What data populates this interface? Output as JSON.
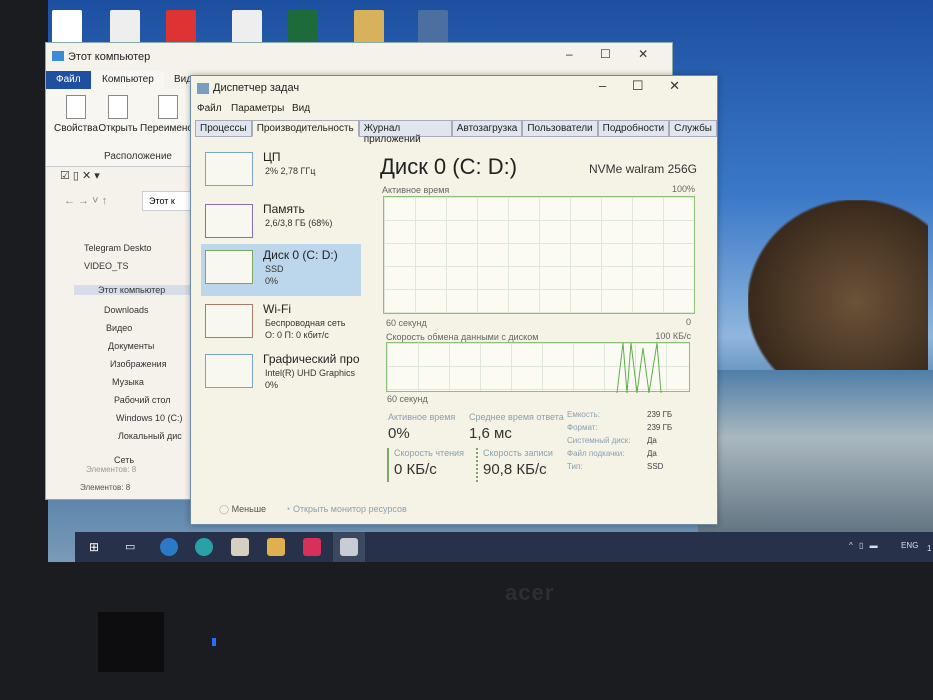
{
  "desktop": {
    "top_icons": [
      "excel-file",
      "blank-file",
      "youtube",
      "document",
      "excel-file",
      "folder",
      "save-file"
    ]
  },
  "explorer": {
    "title": "Этот компьютер",
    "ribbon_tabs": [
      "Файл",
      "Компьютер",
      "Вид"
    ],
    "ribbon_buttons": [
      "Свойства",
      "Открыть",
      "Переименов"
    ],
    "ribbon_group": "Расположение",
    "address": "Этот к",
    "nav_items": [
      "Telegram Deskto",
      "VIDEO_TS",
      "Этот компьютер",
      "Downloads",
      "Видео",
      "Документы",
      "Изображения",
      "Музыка",
      "Рабочий стол",
      "Windows 10 (C:)",
      "Локальный дис",
      "Сеть"
    ],
    "status": "Элементов: 8",
    "status2": "Элементов: 8"
  },
  "taskmgr": {
    "title": "Диспетчер задач",
    "menu": [
      "Файл",
      "Параметры",
      "Вид"
    ],
    "tabs": [
      "Процессы",
      "Производительность",
      "Журнал приложений",
      "Автозагрузка",
      "Пользователи",
      "Подробности",
      "Службы"
    ],
    "sidebar": [
      {
        "name": "ЦП",
        "sub1": "2% 2,78 ГГц",
        "sub2": ""
      },
      {
        "name": "Память",
        "sub1": "2,6/3,8 ГБ (68%)",
        "sub2": ""
      },
      {
        "name": "Диск 0 (C: D:)",
        "sub1": "SSD",
        "sub2": "0%"
      },
      {
        "name": "Wi-Fi",
        "sub1": "Беспроводная сеть",
        "sub2": "О: 0 П: 0 кбит/с"
      },
      {
        "name": "Графический про",
        "sub1": "Intel(R) UHD Graphics",
        "sub2": "0%"
      }
    ],
    "main": {
      "title": "Диск 0 (C: D:)",
      "model": "NVMe walram 256G",
      "chart1_label": "Активное время",
      "chart1_max": "100%",
      "chart1_time": "60 секунд",
      "chart1_min": "0",
      "chart2_label": "Скорость обмена данными с диском",
      "chart2_max": "100 КБ/с",
      "chart2_time": "60 секунд",
      "chart2_min": "0",
      "active_time_label": "Активное время",
      "active_time": "0%",
      "response_label": "Среднее время ответа",
      "response": "1,6 мс",
      "read_label": "Скорость чтения",
      "read": "0 КБ/с",
      "write_label": "Скорость записи",
      "write": "90,8 КБ/с",
      "props": [
        {
          "k": "Емкость:",
          "v": "239 ГБ"
        },
        {
          "k": "Формат:",
          "v": "239 ГБ"
        },
        {
          "k": "Системный диск:",
          "v": "Да"
        },
        {
          "k": "Файл подкачки:",
          "v": "Да"
        },
        {
          "k": "Тип:",
          "v": "SSD"
        }
      ]
    },
    "footer": {
      "less": "Меньше",
      "monitor": "Открыть монитор ресурсов"
    }
  },
  "taskbar": {
    "lang": "ENG",
    "clock": "1"
  },
  "bezel": {
    "logo": "acer"
  }
}
